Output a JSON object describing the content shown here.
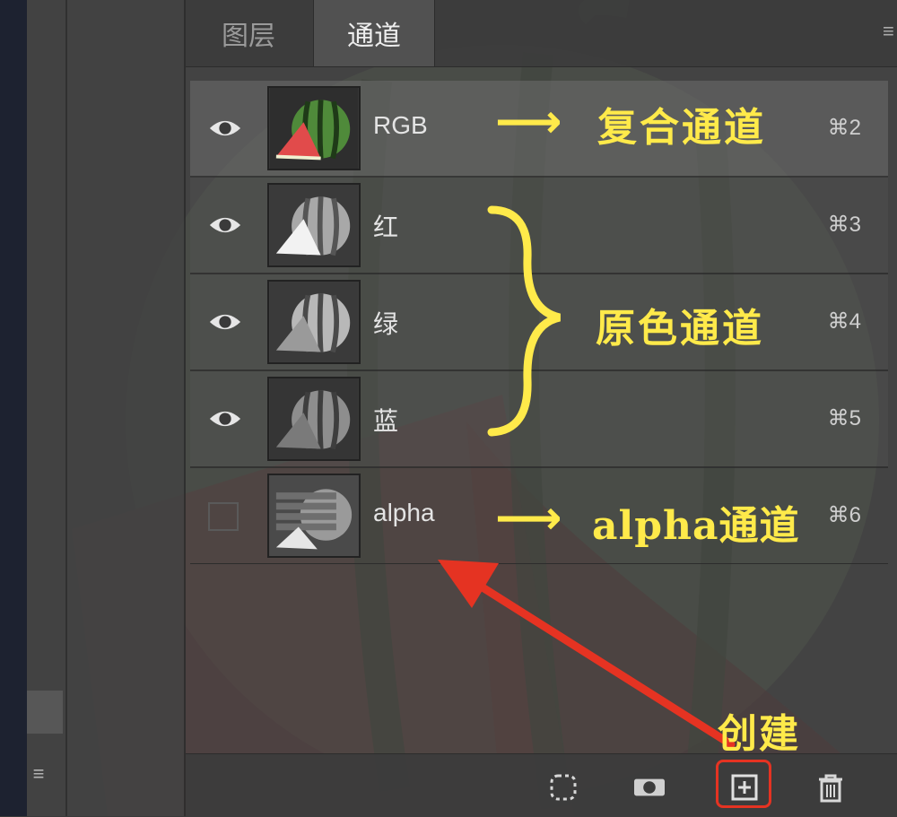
{
  "tabs": [
    {
      "label": "图层",
      "active": false
    },
    {
      "label": "通道",
      "active": true
    }
  ],
  "channels": [
    {
      "name": "RGB",
      "shortcut": "⌘2",
      "visible": true,
      "selected": true
    },
    {
      "name": "红",
      "shortcut": "⌘3",
      "visible": true,
      "selected": false
    },
    {
      "name": "绿",
      "shortcut": "⌘4",
      "visible": true,
      "selected": false
    },
    {
      "name": "蓝",
      "shortcut": "⌘5",
      "visible": true,
      "selected": false
    },
    {
      "name": "alpha",
      "shortcut": "⌘6",
      "visible": false,
      "selected": false
    }
  ],
  "annotations": {
    "composite": "复合通道",
    "primary": "原色通道",
    "alpha": "alpha通道",
    "create": "创建"
  },
  "footer": {
    "icons": [
      "selection-icon",
      "mask-icon",
      "new-channel-icon",
      "trash-icon"
    ]
  },
  "colors": {
    "annotation": "#ffea4a",
    "highlight": "#e53322"
  }
}
